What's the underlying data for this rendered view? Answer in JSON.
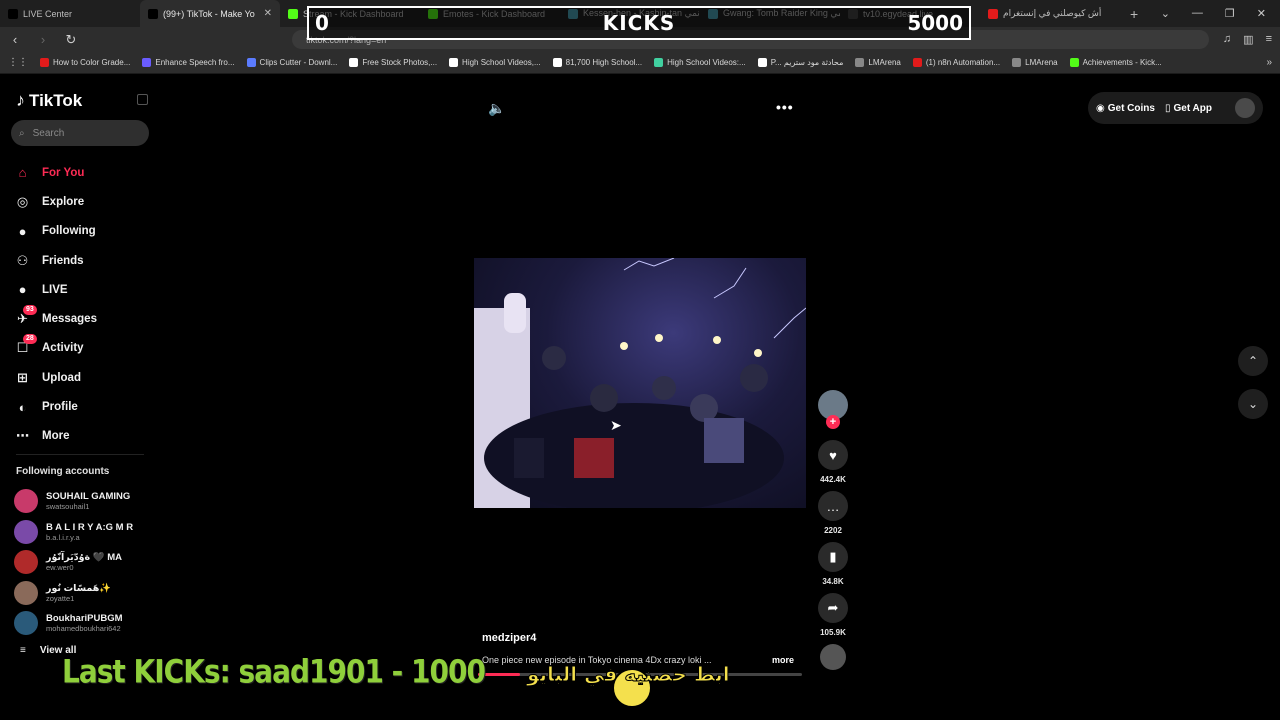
{
  "tabs": [
    {
      "title": "LIVE Center",
      "fav_color": "#000000",
      "active": false
    },
    {
      "title": "(99+) TikTok - Make Yo",
      "fav_color": "#000000",
      "active": true
    },
    {
      "title": "Stream - Kick Dashboard",
      "fav_color": "#53fc18",
      "active": false
    },
    {
      "title": "Emotes - Kick Dashboard",
      "fav_color": "#53fc18",
      "active": false
    },
    {
      "title": "Kessen-hen - Kashin-tan انمي",
      "fav_color": "#4aa3b5",
      "active": false
    },
    {
      "title": "Gwang: Tomb Raider King انمي",
      "fav_color": "#4aa3b5",
      "active": false
    },
    {
      "title": "tv10.egydead.live",
      "fav_color": "#444444",
      "active": false
    },
    {
      "title": "أش كيوصلني في إنستغرام",
      "fav_color": "#e21b1b",
      "active": false
    }
  ],
  "address": {
    "url": "tiktok.com/?lang=en"
  },
  "bookmarks": [
    {
      "label": "How to Color Grade...",
      "color": "#e21b1b"
    },
    {
      "label": "Enhance Speech fro...",
      "color": "#6a5cff"
    },
    {
      "label": "Clips Cutter - Downl...",
      "color": "#5b7cff"
    },
    {
      "label": "Free Stock Photos,...",
      "color": "#ffffff"
    },
    {
      "label": "High School Videos,...",
      "color": "#ffffff"
    },
    {
      "label": "81,700 High School...",
      "color": "#ffffff"
    },
    {
      "label": "High School Videos:...",
      "color": "#41d0a0"
    },
    {
      "label": "P... محادثة مود ستريم",
      "color": "#ffffff"
    },
    {
      "label": "LMArena",
      "color": "#888888"
    },
    {
      "label": "(1) n8n Automation...",
      "color": "#e21b1b"
    },
    {
      "label": "LMArena",
      "color": "#888888"
    },
    {
      "label": "Achievements - Kick...",
      "color": "#53fc18"
    }
  ],
  "overlay": {
    "kicks_left": "0",
    "kicks_title": "KICKS",
    "kicks_goal": "5000",
    "last_kicks": "Last KICKs: saad1901 - 1000",
    "arabic_text": "ابط حصنيه في البايو"
  },
  "tiktok": {
    "logo": "TikTok",
    "search_placeholder": "Search",
    "menu": [
      {
        "label": "For You",
        "icon": "home-icon",
        "glyph": "⌂",
        "active": true,
        "badge": ""
      },
      {
        "label": "Explore",
        "icon": "compass-icon",
        "glyph": "◎",
        "active": false,
        "badge": ""
      },
      {
        "label": "Following",
        "icon": "following-icon",
        "glyph": "●",
        "active": false,
        "badge": ""
      },
      {
        "label": "Friends",
        "icon": "friends-icon",
        "glyph": "⚇",
        "active": false,
        "badge": ""
      },
      {
        "label": "LIVE",
        "icon": "live-icon",
        "glyph": "●",
        "active": false,
        "badge": ""
      },
      {
        "label": "Messages",
        "icon": "messages-icon",
        "glyph": "✈",
        "active": false,
        "badge": "93"
      },
      {
        "label": "Activity",
        "icon": "activity-icon",
        "glyph": "☐",
        "active": false,
        "badge": "28"
      },
      {
        "label": "Upload",
        "icon": "upload-icon",
        "glyph": "⊞",
        "active": false,
        "badge": ""
      },
      {
        "label": "Profile",
        "icon": "profile-icon",
        "glyph": "◐",
        "active": false,
        "badge": ""
      },
      {
        "label": "More",
        "icon": "more-icon",
        "glyph": "⋯",
        "active": false,
        "badge": ""
      }
    ],
    "following_title": "Following accounts",
    "accounts": [
      {
        "name": "SOUHAIL GAMING",
        "handle": "swatsouhail1",
        "color": "#c83a6a"
      },
      {
        "name": "B A L I R Y A:G M R",
        "handle": "b.a.l.i.r.y.a",
        "color": "#7a4aa8"
      },
      {
        "name": "ةوُدّيَرآنّوُر 🖤 MA",
        "handle": "ew.wer0",
        "color": "#b02a2a"
      },
      {
        "name": "هَمسًات نُور✨",
        "handle": "zoyatte1",
        "color": "#8a6a5a"
      },
      {
        "name": "BoukhariPUBGM",
        "handle": "mohamedboukhari642",
        "color": "#2a5a7a"
      }
    ],
    "view_all": "View all",
    "get_coins": "Get Coins",
    "get_app": "Get App",
    "video": {
      "username": "medziper4",
      "caption": "One piece new episode in Tokyo cinema 4Dx crazy loki ...",
      "more": "more",
      "likes": "442.4K",
      "comments": "2202",
      "saves": "34.8K",
      "shares": "105.9K",
      "progress": 0.13
    }
  },
  "colors": {
    "accent": "#fe2c55",
    "kick_green": "#53fc18",
    "overlay_green": "#8fcf3b"
  }
}
